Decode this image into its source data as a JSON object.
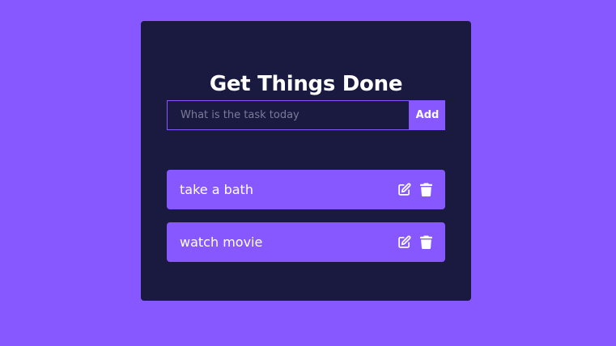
{
  "app": {
    "title": "Get Things Done"
  },
  "form": {
    "placeholder": "What is the task today",
    "value": "",
    "add_label": "Add"
  },
  "todos": [
    {
      "text": "take a bath",
      "edit_icon": "edit-icon",
      "delete_icon": "trash-icon"
    },
    {
      "text": "watch movie",
      "edit_icon": "edit-icon",
      "delete_icon": "trash-icon"
    }
  ],
  "colors": {
    "background": "#8758ff",
    "card": "#1a1a40",
    "accent": "#8758ff",
    "text": "#ffffff",
    "placeholder": "#7b7a98"
  }
}
